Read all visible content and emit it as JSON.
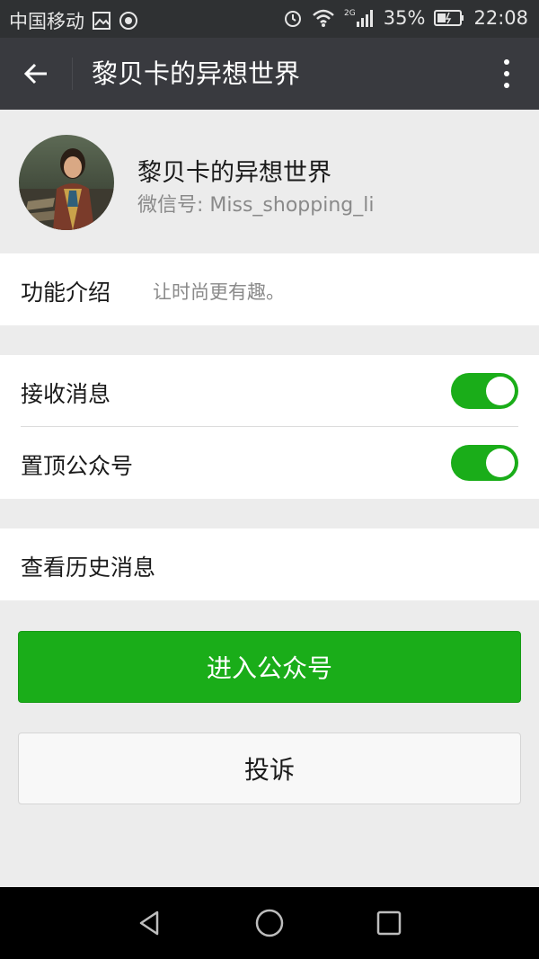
{
  "status_bar": {
    "carrier": "中国移动",
    "network": "2G",
    "battery": "35%",
    "time": "22:08",
    "icons": [
      "image-icon",
      "notification-icon",
      "alarm-icon",
      "wifi-icon",
      "signal-icon",
      "battery-icon"
    ]
  },
  "header": {
    "title": "黎贝卡的异想世界",
    "back_icon": "back-arrow-icon",
    "more_icon": "more-vertical-icon"
  },
  "profile": {
    "name": "黎贝卡的异想世界",
    "wechat_id": "微信号: Miss_shopping_li"
  },
  "function_intro": {
    "label": "功能介绍",
    "value": "让时尚更有趣。"
  },
  "settings": {
    "receive_messages": {
      "label": "接收消息",
      "on": true
    },
    "pin_account": {
      "label": "置顶公众号",
      "on": true
    }
  },
  "history": {
    "label": "查看历史消息"
  },
  "buttons": {
    "enter": "进入公众号",
    "report": "投诉"
  },
  "colors": {
    "accent_green": "#1aad19",
    "header_bg": "#393a3f",
    "page_bg": "#ececec"
  }
}
